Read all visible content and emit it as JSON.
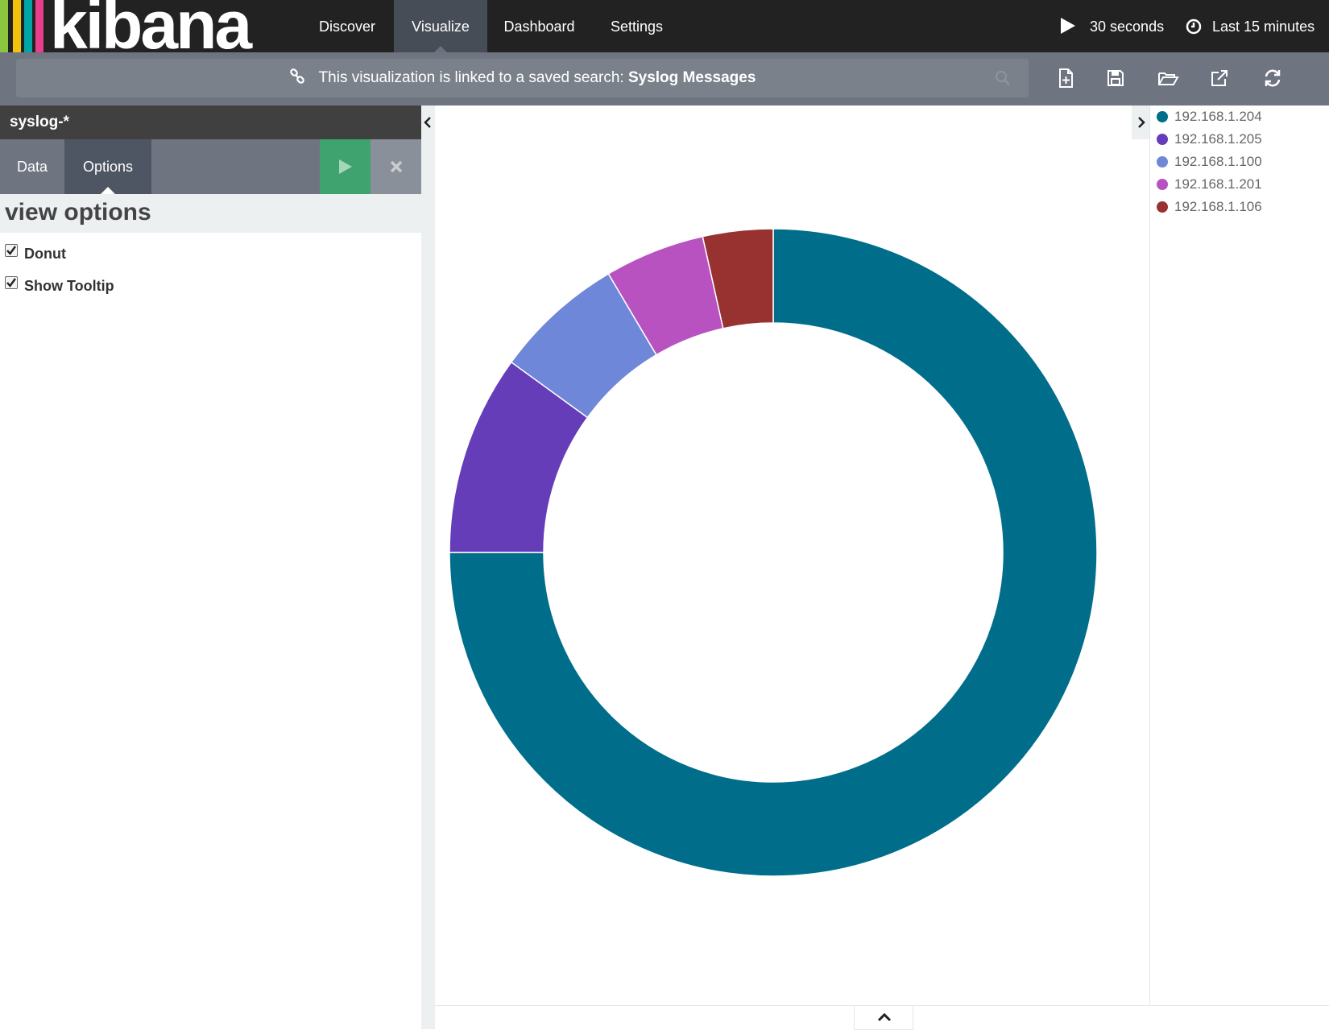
{
  "app": {
    "logo_text": "kibana",
    "logo_stripes": [
      "#8cc63f",
      "#f4c20d",
      "#00a6a6",
      "#e83e8c"
    ]
  },
  "nav": {
    "tabs": [
      {
        "label": "Discover"
      },
      {
        "label": "Visualize"
      },
      {
        "label": "Dashboard"
      },
      {
        "label": "Settings"
      }
    ],
    "active": "Visualize",
    "refresh_interval": "30 seconds",
    "time_range": "Last 15 minutes"
  },
  "search_bar": {
    "linked_prefix": "This visualization is linked to a saved search:",
    "saved_search": "Syslog Messages"
  },
  "toolbar": {
    "icons": [
      "new-visualization-icon",
      "save-icon",
      "open-icon",
      "share-icon",
      "refresh-icon"
    ]
  },
  "sidebar": {
    "index_pattern": "syslog-*",
    "tabs": [
      {
        "label": "Data"
      },
      {
        "label": "Options"
      }
    ],
    "active_tab": "Options",
    "section_title": "view options",
    "options": [
      {
        "label": "Donut",
        "checked": true
      },
      {
        "label": "Show Tooltip",
        "checked": true
      }
    ]
  },
  "chart_data": {
    "type": "pie",
    "donut": true,
    "title": "",
    "legend_position": "right",
    "categories": [
      "192.168.1.204",
      "192.168.1.205",
      "192.168.1.100",
      "192.168.1.201",
      "192.168.1.106"
    ],
    "values": [
      75,
      10,
      6.5,
      5,
      3.5
    ],
    "colors": [
      "#006e8a",
      "#663db8",
      "#6f87d8",
      "#b952c1",
      "#983231"
    ]
  }
}
